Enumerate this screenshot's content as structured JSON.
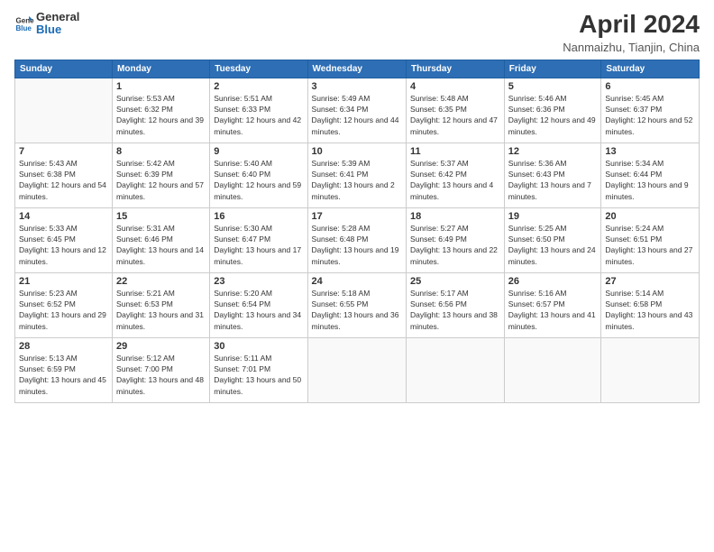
{
  "logo": {
    "line1": "General",
    "line2": "Blue"
  },
  "title": "April 2024",
  "location": "Nanmaizhu, Tianjin, China",
  "weekdays": [
    "Sunday",
    "Monday",
    "Tuesday",
    "Wednesday",
    "Thursday",
    "Friday",
    "Saturday"
  ],
  "weeks": [
    [
      {
        "day": "",
        "sunrise": "",
        "sunset": "",
        "daylight": ""
      },
      {
        "day": "1",
        "sunrise": "Sunrise: 5:53 AM",
        "sunset": "Sunset: 6:32 PM",
        "daylight": "Daylight: 12 hours and 39 minutes."
      },
      {
        "day": "2",
        "sunrise": "Sunrise: 5:51 AM",
        "sunset": "Sunset: 6:33 PM",
        "daylight": "Daylight: 12 hours and 42 minutes."
      },
      {
        "day": "3",
        "sunrise": "Sunrise: 5:49 AM",
        "sunset": "Sunset: 6:34 PM",
        "daylight": "Daylight: 12 hours and 44 minutes."
      },
      {
        "day": "4",
        "sunrise": "Sunrise: 5:48 AM",
        "sunset": "Sunset: 6:35 PM",
        "daylight": "Daylight: 12 hours and 47 minutes."
      },
      {
        "day": "5",
        "sunrise": "Sunrise: 5:46 AM",
        "sunset": "Sunset: 6:36 PM",
        "daylight": "Daylight: 12 hours and 49 minutes."
      },
      {
        "day": "6",
        "sunrise": "Sunrise: 5:45 AM",
        "sunset": "Sunset: 6:37 PM",
        "daylight": "Daylight: 12 hours and 52 minutes."
      }
    ],
    [
      {
        "day": "7",
        "sunrise": "Sunrise: 5:43 AM",
        "sunset": "Sunset: 6:38 PM",
        "daylight": "Daylight: 12 hours and 54 minutes."
      },
      {
        "day": "8",
        "sunrise": "Sunrise: 5:42 AM",
        "sunset": "Sunset: 6:39 PM",
        "daylight": "Daylight: 12 hours and 57 minutes."
      },
      {
        "day": "9",
        "sunrise": "Sunrise: 5:40 AM",
        "sunset": "Sunset: 6:40 PM",
        "daylight": "Daylight: 12 hours and 59 minutes."
      },
      {
        "day": "10",
        "sunrise": "Sunrise: 5:39 AM",
        "sunset": "Sunset: 6:41 PM",
        "daylight": "Daylight: 13 hours and 2 minutes."
      },
      {
        "day": "11",
        "sunrise": "Sunrise: 5:37 AM",
        "sunset": "Sunset: 6:42 PM",
        "daylight": "Daylight: 13 hours and 4 minutes."
      },
      {
        "day": "12",
        "sunrise": "Sunrise: 5:36 AM",
        "sunset": "Sunset: 6:43 PM",
        "daylight": "Daylight: 13 hours and 7 minutes."
      },
      {
        "day": "13",
        "sunrise": "Sunrise: 5:34 AM",
        "sunset": "Sunset: 6:44 PM",
        "daylight": "Daylight: 13 hours and 9 minutes."
      }
    ],
    [
      {
        "day": "14",
        "sunrise": "Sunrise: 5:33 AM",
        "sunset": "Sunset: 6:45 PM",
        "daylight": "Daylight: 13 hours and 12 minutes."
      },
      {
        "day": "15",
        "sunrise": "Sunrise: 5:31 AM",
        "sunset": "Sunset: 6:46 PM",
        "daylight": "Daylight: 13 hours and 14 minutes."
      },
      {
        "day": "16",
        "sunrise": "Sunrise: 5:30 AM",
        "sunset": "Sunset: 6:47 PM",
        "daylight": "Daylight: 13 hours and 17 minutes."
      },
      {
        "day": "17",
        "sunrise": "Sunrise: 5:28 AM",
        "sunset": "Sunset: 6:48 PM",
        "daylight": "Daylight: 13 hours and 19 minutes."
      },
      {
        "day": "18",
        "sunrise": "Sunrise: 5:27 AM",
        "sunset": "Sunset: 6:49 PM",
        "daylight": "Daylight: 13 hours and 22 minutes."
      },
      {
        "day": "19",
        "sunrise": "Sunrise: 5:25 AM",
        "sunset": "Sunset: 6:50 PM",
        "daylight": "Daylight: 13 hours and 24 minutes."
      },
      {
        "day": "20",
        "sunrise": "Sunrise: 5:24 AM",
        "sunset": "Sunset: 6:51 PM",
        "daylight": "Daylight: 13 hours and 27 minutes."
      }
    ],
    [
      {
        "day": "21",
        "sunrise": "Sunrise: 5:23 AM",
        "sunset": "Sunset: 6:52 PM",
        "daylight": "Daylight: 13 hours and 29 minutes."
      },
      {
        "day": "22",
        "sunrise": "Sunrise: 5:21 AM",
        "sunset": "Sunset: 6:53 PM",
        "daylight": "Daylight: 13 hours and 31 minutes."
      },
      {
        "day": "23",
        "sunrise": "Sunrise: 5:20 AM",
        "sunset": "Sunset: 6:54 PM",
        "daylight": "Daylight: 13 hours and 34 minutes."
      },
      {
        "day": "24",
        "sunrise": "Sunrise: 5:18 AM",
        "sunset": "Sunset: 6:55 PM",
        "daylight": "Daylight: 13 hours and 36 minutes."
      },
      {
        "day": "25",
        "sunrise": "Sunrise: 5:17 AM",
        "sunset": "Sunset: 6:56 PM",
        "daylight": "Daylight: 13 hours and 38 minutes."
      },
      {
        "day": "26",
        "sunrise": "Sunrise: 5:16 AM",
        "sunset": "Sunset: 6:57 PM",
        "daylight": "Daylight: 13 hours and 41 minutes."
      },
      {
        "day": "27",
        "sunrise": "Sunrise: 5:14 AM",
        "sunset": "Sunset: 6:58 PM",
        "daylight": "Daylight: 13 hours and 43 minutes."
      }
    ],
    [
      {
        "day": "28",
        "sunrise": "Sunrise: 5:13 AM",
        "sunset": "Sunset: 6:59 PM",
        "daylight": "Daylight: 13 hours and 45 minutes."
      },
      {
        "day": "29",
        "sunrise": "Sunrise: 5:12 AM",
        "sunset": "Sunset: 7:00 PM",
        "daylight": "Daylight: 13 hours and 48 minutes."
      },
      {
        "day": "30",
        "sunrise": "Sunrise: 5:11 AM",
        "sunset": "Sunset: 7:01 PM",
        "daylight": "Daylight: 13 hours and 50 minutes."
      },
      {
        "day": "",
        "sunrise": "",
        "sunset": "",
        "daylight": ""
      },
      {
        "day": "",
        "sunrise": "",
        "sunset": "",
        "daylight": ""
      },
      {
        "day": "",
        "sunrise": "",
        "sunset": "",
        "daylight": ""
      },
      {
        "day": "",
        "sunrise": "",
        "sunset": "",
        "daylight": ""
      }
    ]
  ]
}
